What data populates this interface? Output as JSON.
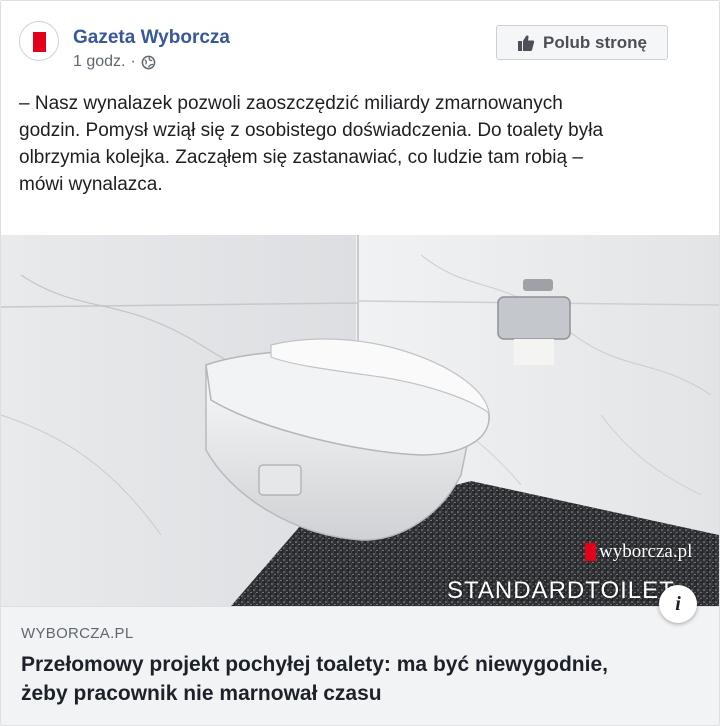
{
  "post": {
    "page_name": "Gazeta Wyborcza",
    "timestamp": "1 godz.",
    "separator": "·",
    "privacy_icon": "globe-icon",
    "like_page_label": "Polub stronę",
    "like_icon": "thumbs-up-icon",
    "text_lines": [
      "– Nasz wynalazek pozwoli zaoszczędzić miliardy zmarnowanych",
      "godzin. Pomysł wziął się z osobistego doświadczenia. Do toalety była",
      "olbrzymia kolejka. Zacząłem się zastanawiać, co ludzie tam robią –",
      "mówi wynalazca."
    ]
  },
  "image": {
    "watermark_logo": "wyborcza.pl",
    "watermark_text": "STANDARDTOILET",
    "info_button_label": "i"
  },
  "link": {
    "domain": "WYBORCZA.PL",
    "title_lines": [
      "Przełomowy projekt pochyłej toalety: ma być niewygodnie,",
      "żeby pracownik nie marnował czasu"
    ]
  },
  "colors": {
    "page_name": "#385898",
    "brand_red": "#e3001b",
    "link_box_bg": "#f2f3f5"
  }
}
